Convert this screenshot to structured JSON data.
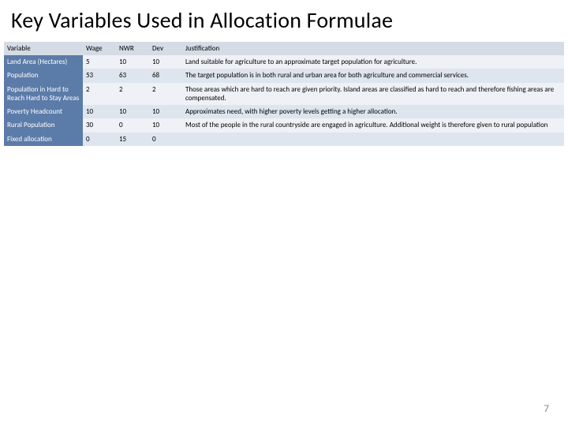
{
  "title": "Key Variables Used in Allocation Formulae",
  "headers": {
    "variable": "Variable",
    "wage": "Wage",
    "nwr": "NWR",
    "dev": "Dev",
    "justification": "Justification"
  },
  "rows": [
    {
      "variable": "Land Area (Hectares)",
      "wage": "5",
      "nwr": "10",
      "dev": "10",
      "justification": "Land suitable for agriculture to an approximate target population for agriculture."
    },
    {
      "variable": "Population",
      "wage": "53",
      "nwr": "63",
      "dev": "68",
      "justification": "The target population is in both rural and urban area for both agriculture and commercial services."
    },
    {
      "variable": "Population in Hard to Reach Hard to Stay Areas",
      "wage": "2",
      "nwr": "2",
      "dev": "2",
      "justification": "Those areas which are hard to reach are given priority. Island areas are classified as hard to reach and therefore fishing areas are compensated."
    },
    {
      "variable": "Poverty Headcount",
      "wage": "10",
      "nwr": "10",
      "dev": "10",
      "justification": "Approximates need, with higher poverty levels getting a higher allocation."
    },
    {
      "variable": "Rural Population",
      "wage": "30",
      "nwr": "0",
      "dev": "10",
      "justification": "Most of the people in the rural countryside are engaged in agriculture. Additional weight is therefore given to rural population"
    },
    {
      "variable": "Fixed allocation",
      "wage": "0",
      "nwr": "15",
      "dev": "0",
      "justification": ""
    }
  ],
  "page_number": "7"
}
